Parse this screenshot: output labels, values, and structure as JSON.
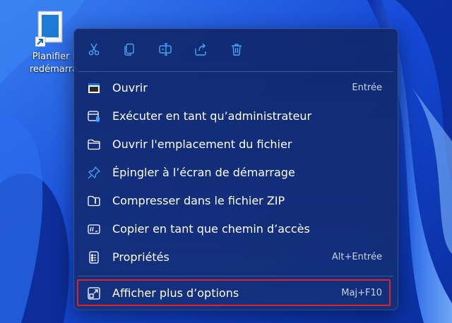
{
  "desktop": {
    "shortcut_label_line1": "Planifier l",
    "shortcut_label_line2": "redémarra"
  },
  "toolbar": {
    "cut": "scissors-icon",
    "copy": "copy-icon",
    "rename": "rename-icon",
    "share": "share-icon",
    "delete": "trash-icon"
  },
  "menu": {
    "items": [
      {
        "label": "Ouvrir",
        "shortcut": "Entrée",
        "icon": "window-icon"
      },
      {
        "label": "Exécuter en tant qu’administrateur",
        "shortcut": "",
        "icon": "shield-window-icon"
      },
      {
        "label": "Ouvrir l'emplacement du fichier",
        "shortcut": "",
        "icon": "folder-icon"
      },
      {
        "label": "Épingler à l’écran de démarrage",
        "shortcut": "",
        "icon": "pin-icon"
      },
      {
        "label": "Compresser dans le fichier ZIP",
        "shortcut": "",
        "icon": "zip-folder-icon"
      },
      {
        "label": "Copier en tant que chemin d’accès",
        "shortcut": "",
        "icon": "path-icon"
      },
      {
        "label": "Propriétés",
        "shortcut": "Alt+Entrée",
        "icon": "properties-icon"
      }
    ],
    "more_options": {
      "label": "Afficher plus d’options",
      "shortcut": "Maj+F10",
      "icon": "expand-icon"
    }
  },
  "colors": {
    "accent": "#4aa3f5",
    "highlight_border": "#e0222b",
    "menu_bg": "#12306f"
  }
}
